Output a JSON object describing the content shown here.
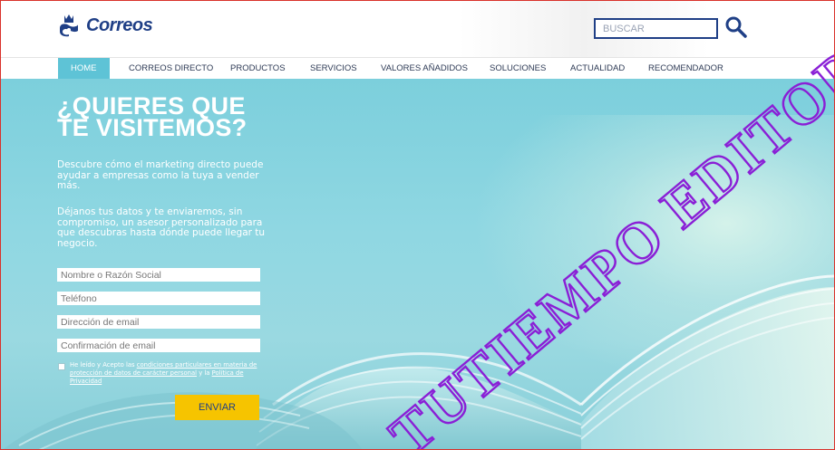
{
  "brand": {
    "name": "Correos"
  },
  "search": {
    "placeholder": "BUSCAR"
  },
  "nav": {
    "items": [
      {
        "label": "HOME",
        "active": true
      },
      {
        "label": "CORREOS DIRECTO"
      },
      {
        "label": "PRODUCTOS"
      },
      {
        "label": "SERVICIOS"
      },
      {
        "label": "VALORES AÑADIDOS"
      },
      {
        "label": "SOLUCIONES"
      },
      {
        "label": "ACTUALIDAD"
      },
      {
        "label": "RECOMENDADOR"
      }
    ]
  },
  "hero": {
    "headline_line1": "¿QUIERES QUE",
    "headline_line2": "TE VISITEMOS?",
    "paragraph1": "Descubre cómo el marketing directo puede ayudar a empresas como la tuya a vender más.",
    "paragraph2": "Déjanos tus datos y te enviaremos, sin compromiso, un asesor personalizado para que descubras hasta dónde puede llegar tu negocio."
  },
  "form": {
    "name_placeholder": "Nombre o Razón Social",
    "phone_placeholder": "Teléfono",
    "email_placeholder": "Dirección de email",
    "email_confirm_placeholder": "Confirmación de email",
    "legal_prefix": "He leído y Acepto las ",
    "legal_link1": "condiciones particulares en materia de protección de datos de carácter personal",
    "legal_middle": " y la ",
    "legal_link2": "Política de Privacidad",
    "submit_label": "ENVIAR"
  },
  "watermark": {
    "text": "TUTIEMPO EDITORIAL"
  },
  "colors": {
    "brand_blue": "#1f3f86",
    "accent_cyan": "#5ec3d6",
    "button_yellow": "#f6c400",
    "watermark_purple": "#8a1fd6",
    "frame_red": "#d9322b"
  }
}
